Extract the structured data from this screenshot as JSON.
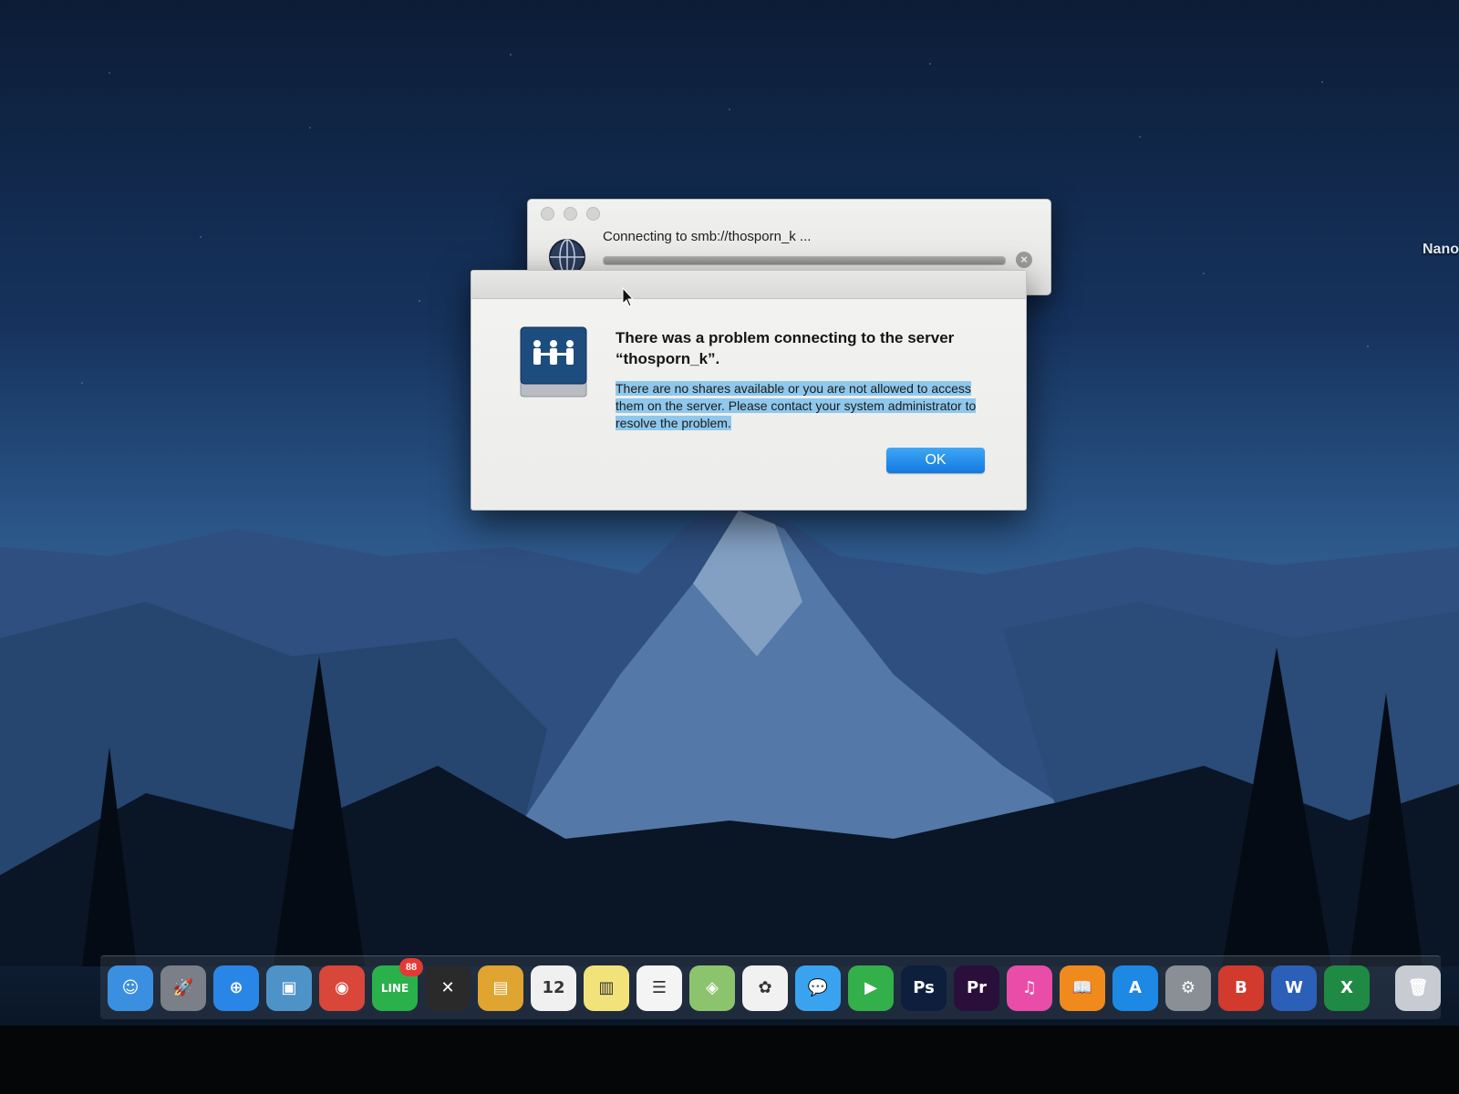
{
  "desktop": {
    "side_label": "Nano"
  },
  "progress_window": {
    "title": "Connecting to smb://thosporn_k ...",
    "progress_fraction": 1.0,
    "stop_symbol": "×"
  },
  "alert": {
    "title": "There was a problem connecting to the server “thosporn_k”.",
    "message": "There are no shares available or you are not allowed to access them on the server. Please contact your system administrator to resolve the problem.",
    "ok_label": "OK",
    "accent_color": "#1a7fe6",
    "selection_color": "#8fc8ec"
  },
  "dock": {
    "items": [
      {
        "name": "finder",
        "glyph": "☺",
        "color": "#3b8fe0"
      },
      {
        "name": "launchpad",
        "glyph": "🚀",
        "color": "#7a7f88"
      },
      {
        "name": "safari",
        "glyph": "⊕",
        "color": "#2a86e6"
      },
      {
        "name": "preview",
        "glyph": "▣",
        "color": "#4e93c8"
      },
      {
        "name": "chrome",
        "glyph": "◉",
        "color": "#d9463a"
      },
      {
        "name": "line",
        "glyph": "LINE",
        "color": "#2bb14b",
        "badge": "88"
      },
      {
        "name": "capcut",
        "glyph": "✕",
        "color": "#2a2a2a"
      },
      {
        "name": "notes-yellow",
        "glyph": "▤",
        "color": "#e0a430"
      },
      {
        "name": "calendar",
        "glyph": "12",
        "color": "#f0f0f0"
      },
      {
        "name": "notes",
        "glyph": "▥",
        "color": "#f1e37a"
      },
      {
        "name": "reminders",
        "glyph": "☰",
        "color": "#f4f4f4"
      },
      {
        "name": "maps",
        "glyph": "◈",
        "color": "#8cc46e"
      },
      {
        "name": "photos",
        "glyph": "✿",
        "color": "#f1f1f1"
      },
      {
        "name": "messages",
        "glyph": "💬",
        "color": "#3aa3f0"
      },
      {
        "name": "facetime",
        "glyph": "▶",
        "color": "#34b04a"
      },
      {
        "name": "photoshop",
        "glyph": "Ps",
        "color": "#0e1f3d"
      },
      {
        "name": "premiere",
        "glyph": "Pr",
        "color": "#2a0f3a"
      },
      {
        "name": "itunes",
        "glyph": "♫",
        "color": "#e94da8"
      },
      {
        "name": "ibooks",
        "glyph": "📖",
        "color": "#f08a1d"
      },
      {
        "name": "app-store",
        "glyph": "A",
        "color": "#1e88e5"
      },
      {
        "name": "system-preferences",
        "glyph": "⚙",
        "color": "#8a8f96"
      },
      {
        "name": "app-b",
        "glyph": "B",
        "color": "#d23a2e"
      },
      {
        "name": "word",
        "glyph": "W",
        "color": "#2b5fb8"
      },
      {
        "name": "excel",
        "glyph": "X",
        "color": "#1f8a43"
      }
    ],
    "trash": {
      "name": "trash",
      "glyph": "🗑",
      "color": "#c8ccd2"
    }
  }
}
